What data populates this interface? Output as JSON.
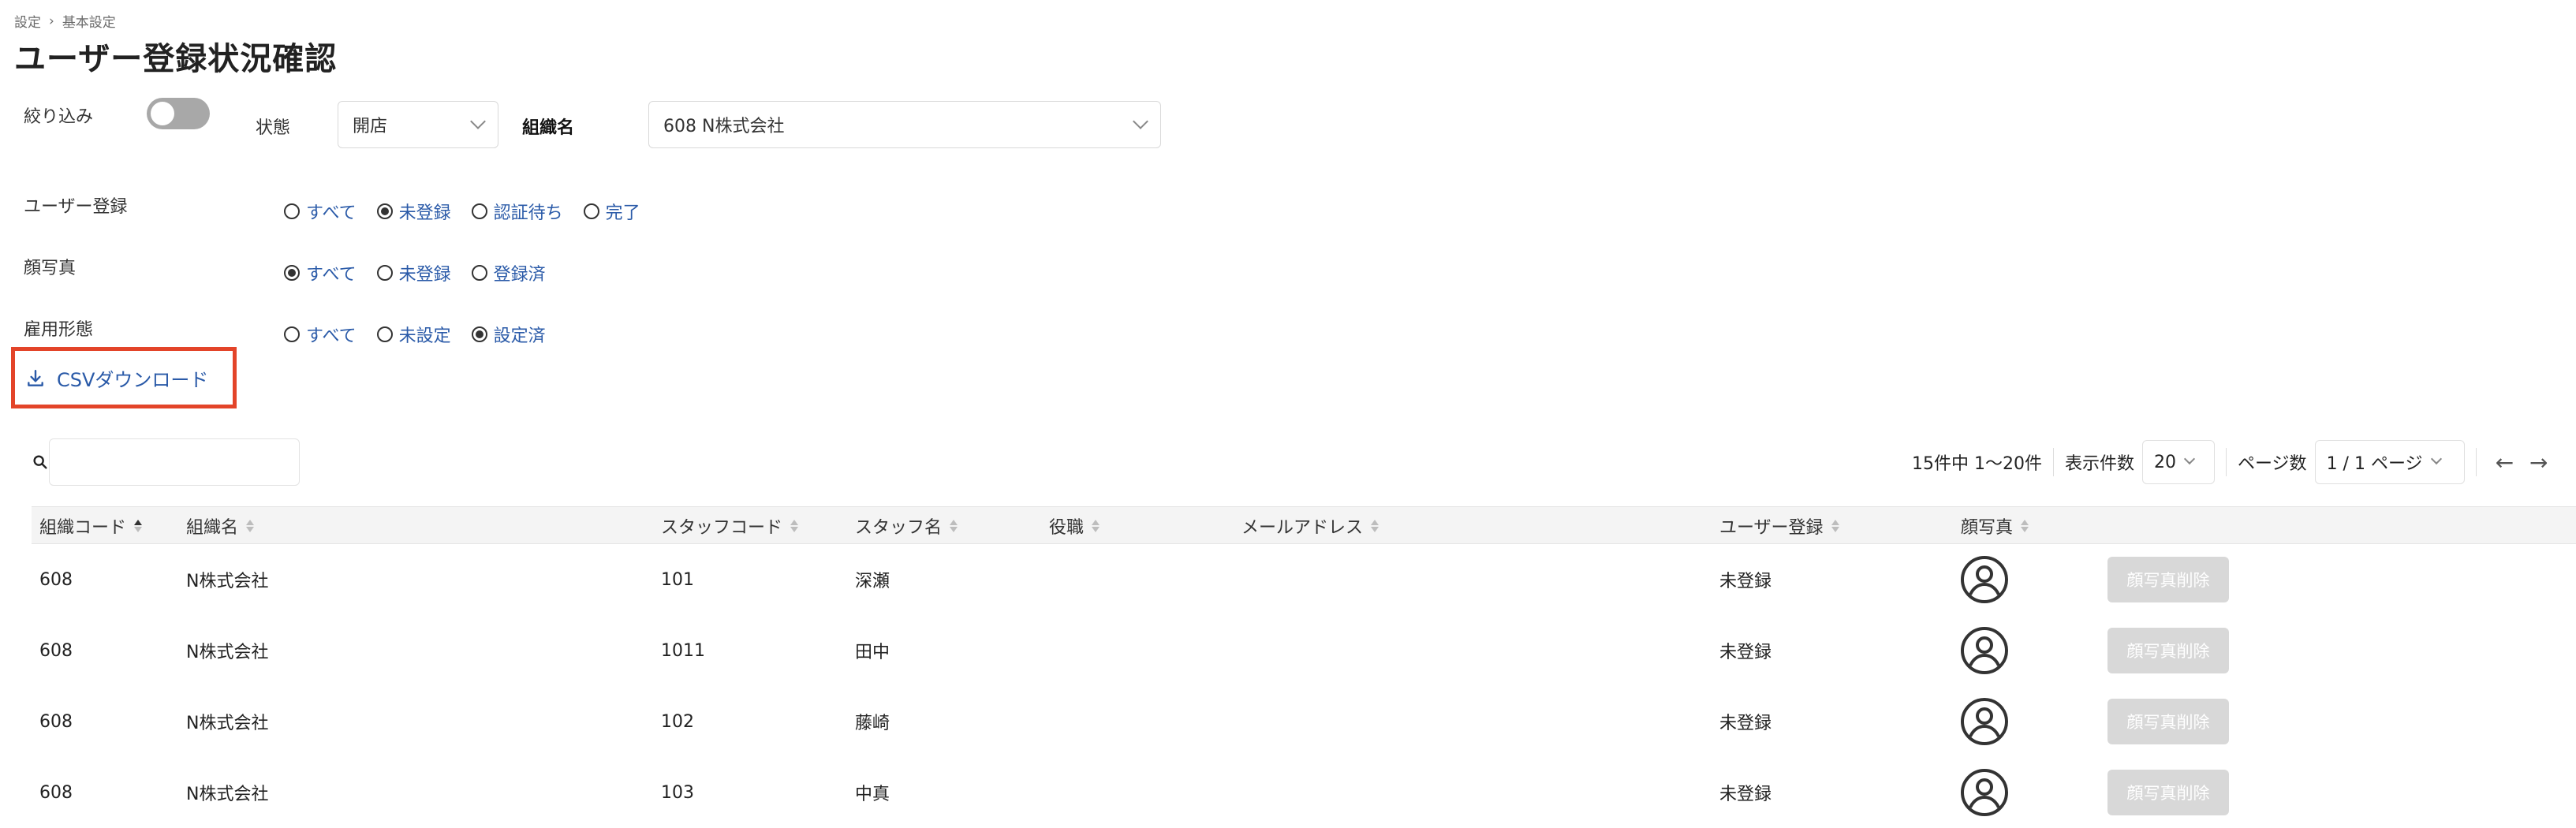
{
  "breadcrumb": [
    "設定",
    "基本設定"
  ],
  "page_title": "ユーザー登録状況確認",
  "filters": {
    "narrow_label": "絞り込み",
    "state_label": "状態",
    "state_value": "開店",
    "org_label": "組織名",
    "org_value": "608 N株式会社"
  },
  "radio_groups": [
    {
      "label": "ユーザー登録",
      "options": [
        {
          "text": "すべて",
          "on": false
        },
        {
          "text": "未登録",
          "on": true
        },
        {
          "text": "認証待ち",
          "on": false
        },
        {
          "text": "完了",
          "on": false
        }
      ]
    },
    {
      "label": "顔写真",
      "options": [
        {
          "text": "すべて",
          "on": true
        },
        {
          "text": "未登録",
          "on": false
        },
        {
          "text": "登録済",
          "on": false
        }
      ]
    },
    {
      "label": "雇用形態",
      "options": [
        {
          "text": "すべて",
          "on": false
        },
        {
          "text": "未設定",
          "on": false
        },
        {
          "text": "設定済",
          "on": true
        }
      ]
    }
  ],
  "csv_label": "CSVダウンロード",
  "search": {
    "placeholder": ""
  },
  "pager": {
    "summary": "15件中 1〜20件",
    "per_page_label": "表示件数",
    "per_page_value": "20",
    "page_label": "ページ数",
    "page_value": "1 / 1 ページ",
    "prev": "←",
    "next": "→"
  },
  "table": {
    "headers": [
      "組織コード",
      "組織名",
      "スタッフコード",
      "スタッフ名",
      "役職",
      "メールアドレス",
      "ユーザー登録",
      "顔写真"
    ],
    "delete_label": "顔写真削除",
    "rows": [
      [
        "608",
        "N株式会社",
        "101",
        "深瀬",
        "",
        "",
        "未登録"
      ],
      [
        "608",
        "N株式会社",
        "1011",
        "田中",
        "",
        "",
        "未登録"
      ],
      [
        "608",
        "N株式会社",
        "102",
        "藤崎",
        "",
        "",
        "未登録"
      ],
      [
        "608",
        "N株式会社",
        "103",
        "中真",
        "",
        "",
        "未登録"
      ]
    ]
  }
}
